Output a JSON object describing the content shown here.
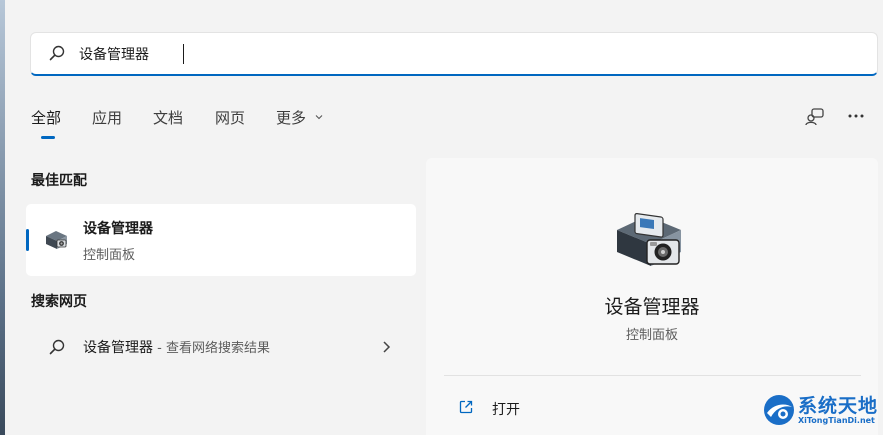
{
  "search": {
    "value": "设备管理器"
  },
  "tabs": [
    {
      "label": "全部",
      "active": true
    },
    {
      "label": "应用",
      "active": false
    },
    {
      "label": "文档",
      "active": false
    },
    {
      "label": "网页",
      "active": false
    },
    {
      "label": "更多",
      "active": false
    }
  ],
  "toolbar_icons": [
    "account-switch-icon",
    "more-options-icon"
  ],
  "best_match": {
    "heading": "最佳匹配",
    "name": "设备管理器",
    "subtitle": "控制面板",
    "icon": "device-manager-icon"
  },
  "web_search": {
    "heading": "搜索网页",
    "query": "设备管理器",
    "suffix": " - 查看网络搜索结果"
  },
  "detail": {
    "title": "设备管理器",
    "subtitle": "控制面板",
    "actions": [
      {
        "label": "打开",
        "icon": "open-external-icon"
      }
    ]
  },
  "watermark": {
    "title": "系统天地",
    "subtitle": "XiTongTianDi.net"
  },
  "colors": {
    "accent": "#0067c0",
    "background": "#f3f3f3",
    "card": "#ffffff"
  }
}
